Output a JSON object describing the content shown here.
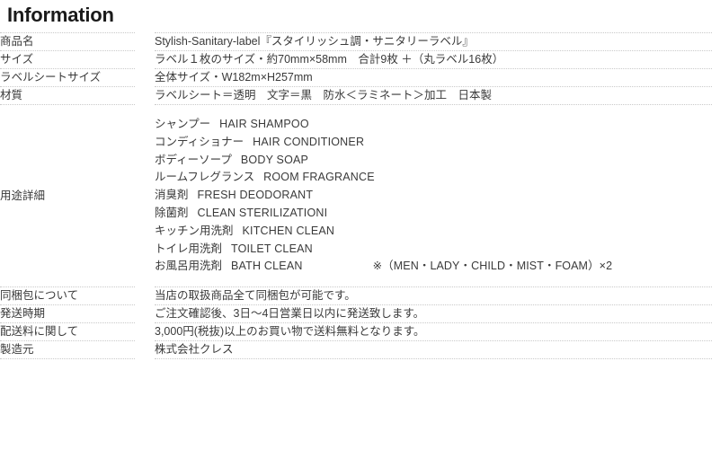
{
  "heading": "Information",
  "table": {
    "rows": [
      {
        "label": "商品名",
        "value": "Stylish-Sanitary-label『スタイリッシュ調・サニタリーラベル』"
      },
      {
        "label": "サイズ",
        "value": "ラベル１枚のサイズ・約70mm×58mm　合計9枚 ＋（丸ラベル16枚）"
      },
      {
        "label": "ラベルシートサイズ",
        "value": "全体サイズ・W182m×H257mm"
      },
      {
        "label": "材質",
        "value": "ラベルシート＝透明　文字＝黒　防水＜ラミネート＞加工　日本製"
      },
      {
        "label": "同梱包について",
        "value": "当店の取扱商品全て同梱包が可能です。"
      },
      {
        "label": "発送時期",
        "value": "ご注文確認後、3日〜4日営業日以内に発送致します。"
      },
      {
        "label": "配送料に関して",
        "value": "3,000円(税抜)以上のお買い物で送料無料となります。"
      },
      {
        "label": "製造元",
        "value": "株式会社クレス"
      }
    ],
    "usage_row": {
      "label": "用途詳細",
      "items": [
        {
          "jp": "シャンプー",
          "en": "HAIR SHAMPOO",
          "note": ""
        },
        {
          "jp": "コンディショナー",
          "en": "HAIR CONDITIONER",
          "note": ""
        },
        {
          "jp": "ボディーソープ",
          "en": "BODY SOAP",
          "note": ""
        },
        {
          "jp": "ルームフレグランス",
          "en": "ROOM FRAGRANCE",
          "note": ""
        },
        {
          "jp": "消臭剤",
          "en": "FRESH DEODORANT",
          "note": ""
        },
        {
          "jp": "除菌剤",
          "en": "CLEAN STERILIZATIONI",
          "note": ""
        },
        {
          "jp": "キッチン用洗剤",
          "en": "KITCHEN CLEAN",
          "note": ""
        },
        {
          "jp": "トイレ用洗剤",
          "en": "TOILET CLEAN",
          "note": ""
        },
        {
          "jp": "お風呂用洗剤",
          "en": "BATH CLEAN",
          "note": "※（MEN・LADY・CHILD・MIST・FOAM）×2"
        }
      ]
    }
  },
  "colors": {
    "text": "#3a3a3a",
    "heading": "#1a1a1a",
    "rule": "#c9c9c9",
    "background": "#ffffff"
  }
}
